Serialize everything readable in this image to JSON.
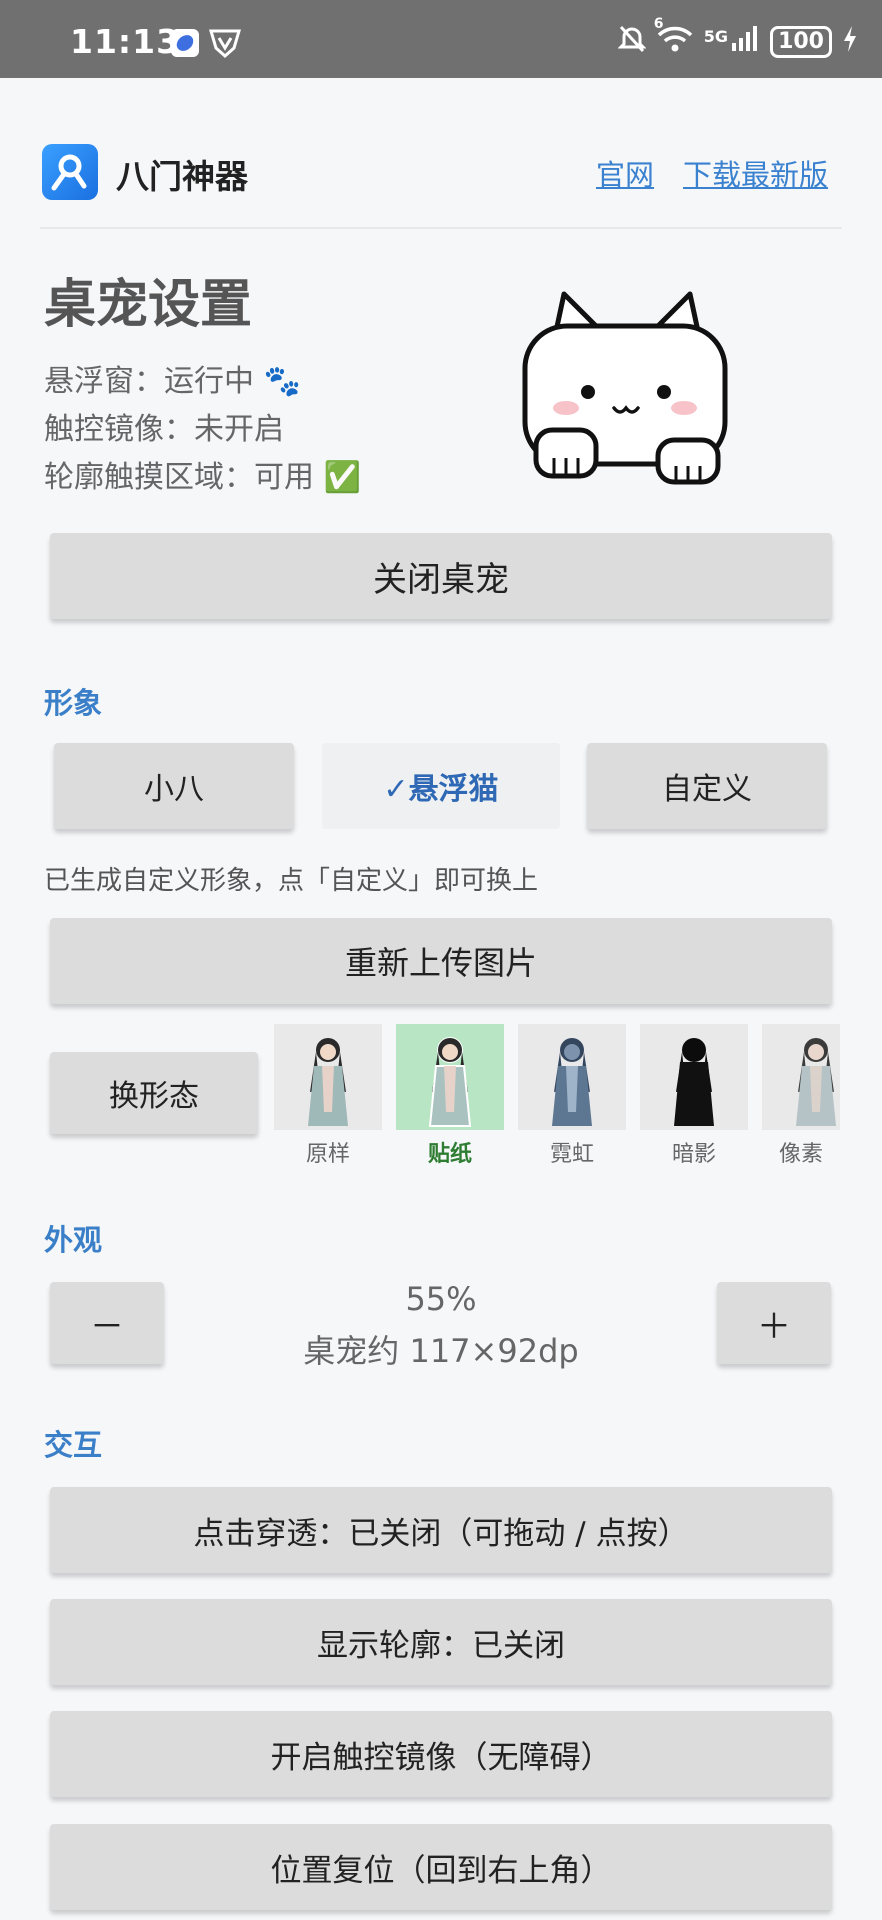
{
  "status_bar": {
    "time": "11:13",
    "network": "5G",
    "signal_prefix": "6",
    "battery": "100",
    "icons": [
      "app-notification-icon",
      "shield-icon",
      "bell-off-icon",
      "wifi-icon",
      "signal-icon",
      "battery-icon",
      "charging-icon"
    ]
  },
  "header": {
    "app_name": "八门神器",
    "link_official": "官网",
    "link_download": "下载最新版"
  },
  "page": {
    "title": "桌宠设置",
    "floating_window": "悬浮窗：运行中 🐾",
    "touch_mirror": "触控镜像：未开启",
    "contour_area": "轮廓触摸区域：可用 ✅"
  },
  "close_button": "关闭桌宠",
  "image_section": {
    "label": "形象",
    "options": [
      "小八",
      "✓悬浮猫",
      "自定义"
    ],
    "selected": "✓悬浮猫",
    "note": "已生成自定义形象，点「自定义」即可换上",
    "reupload_button": "重新上传图片",
    "change_form_button": "换形态",
    "forms": [
      {
        "label": "原样",
        "selected": false
      },
      {
        "label": "贴纸",
        "selected": true
      },
      {
        "label": "霓虹",
        "selected": false
      },
      {
        "label": "暗影",
        "selected": false
      },
      {
        "label": "像素",
        "selected": false
      }
    ]
  },
  "appearance": {
    "label": "外观",
    "minus": "－",
    "plus": "＋",
    "percent": "55%",
    "size_text": "桌宠约 117×92dp"
  },
  "interaction": {
    "label": "交互",
    "click_through": "点击穿透：已关闭（可拖动 / 点按）",
    "show_contour": "显示轮廓：已关闭",
    "touch_mirror": "开启触控镜像（无障碍）",
    "reset_position": "位置复位（回到右上角）"
  },
  "colors": {
    "accent": "#3a7fc8",
    "button_bg": "#dcdcdc",
    "selected_thumb_bg": "#b8e6c4",
    "selected_label": "#2e7d32"
  }
}
